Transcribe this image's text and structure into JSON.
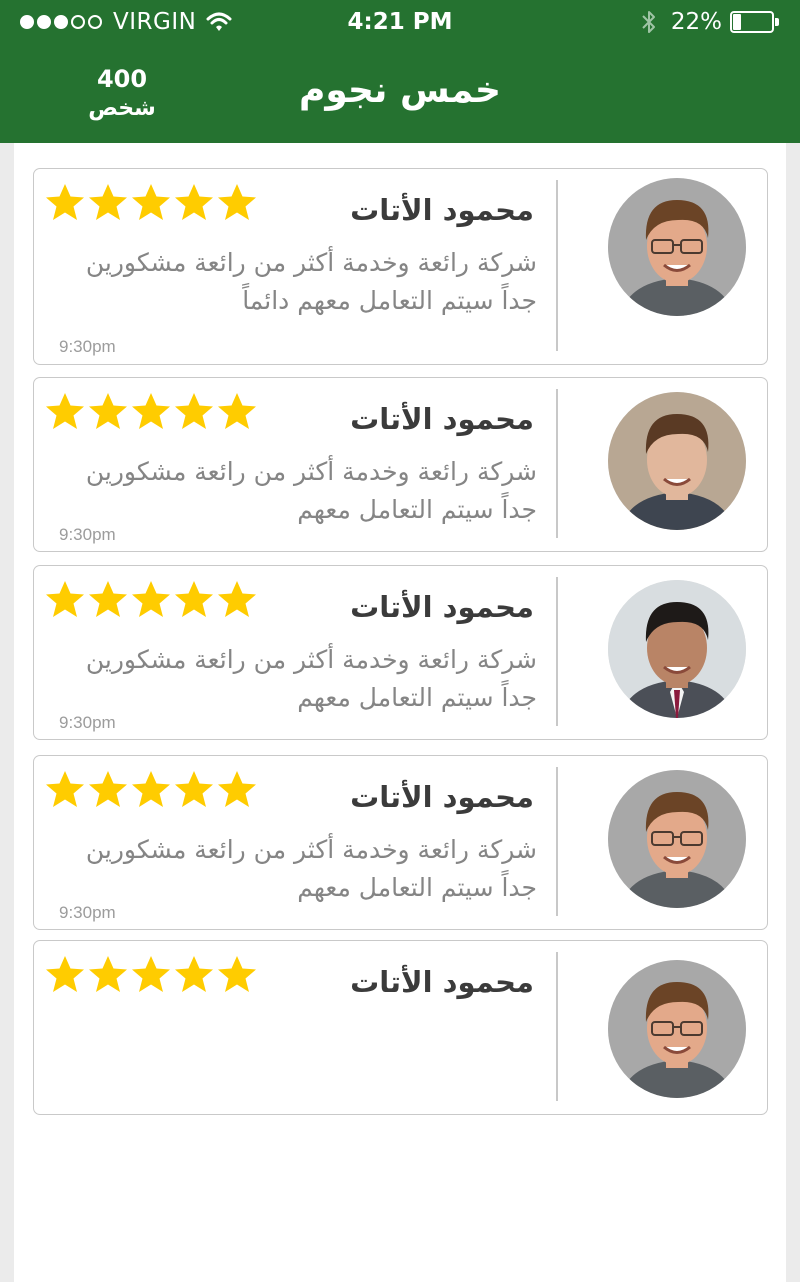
{
  "status_bar": {
    "carrier": "VIRGIN",
    "signal_bars_filled": 3,
    "signal_bars_total": 5,
    "time": "4:21 PM",
    "battery_percent": "22%",
    "battery_level": 0.22
  },
  "header": {
    "title": "خمس نجوم",
    "count": "400",
    "count_unit": "شخص",
    "background_color": "#257230"
  },
  "star_color": "#ffcc00",
  "reviews": [
    {
      "name": "محمود الأتات",
      "rating": 5,
      "text": "شركة رائعة وخدمة أكثر من رائعة مشكورين جداً سيتم التعامل معهم دائماً",
      "time": "9:30pm",
      "avatar": "man-glasses-photo"
    },
    {
      "name": "محمود الأتات",
      "rating": 5,
      "text": "شركة رائعة وخدمة أكثر من رائعة مشكورين جداً سيتم التعامل معهم",
      "time": "9:30pm",
      "avatar": "man-brown-hair-photo"
    },
    {
      "name": "محمود الأتات",
      "rating": 5,
      "text": "شركة رائعة وخدمة أكثر من رائعة مشكورين جداً سيتم التعامل معهم",
      "time": "9:30pm",
      "avatar": "man-suit-photo"
    },
    {
      "name": "محمود الأتات",
      "rating": 5,
      "text": "شركة رائعة وخدمة أكثر من رائعة مشكورين جداً سيتم التعامل معهم",
      "time": "9:30pm",
      "avatar": "man-glasses-photo"
    },
    {
      "name": "محمود الأتات",
      "rating": 5,
      "avatar": "man-glasses-photo"
    }
  ]
}
